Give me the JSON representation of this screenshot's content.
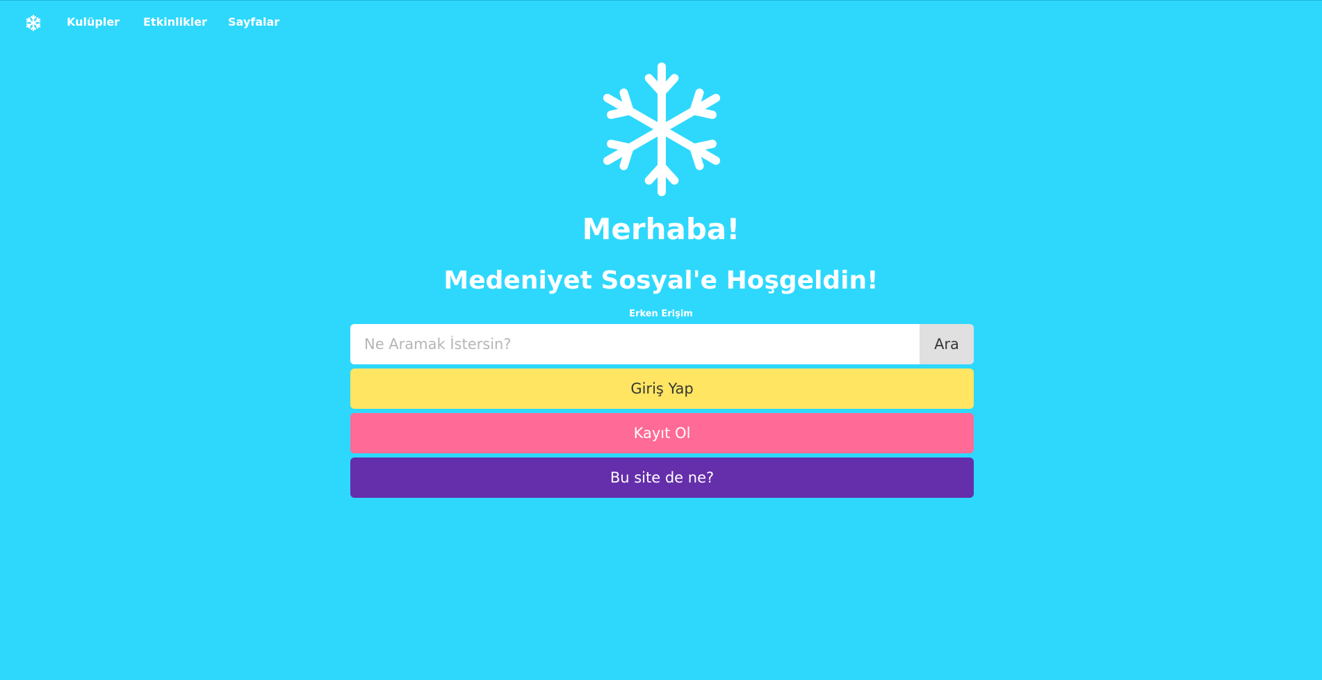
{
  "navbar": {
    "logo_icon": "snowflake-icon",
    "links": [
      {
        "label": "Kulüpler"
      },
      {
        "label": "Etkinlikler"
      },
      {
        "label": "Sayfalar"
      }
    ]
  },
  "hero": {
    "icon": "snowflake-icon",
    "title": "Merhaba!",
    "subtitle": "Medeniyet Sosyal'e Hoşgeldin!",
    "early_access_label": "Erken Erişim"
  },
  "search": {
    "value": "",
    "placeholder": "Ne Aramak İstersin?",
    "button_label": "Ara"
  },
  "actions": {
    "login_label": "Giriş Yap",
    "register_label": "Kayıt Ol",
    "about_label": "Bu site de ne?"
  },
  "colors": {
    "background": "#2ed8fd",
    "login": "#ffe562",
    "register": "#ff6b96",
    "about": "#652eab",
    "search_button": "#e0e0e0"
  }
}
